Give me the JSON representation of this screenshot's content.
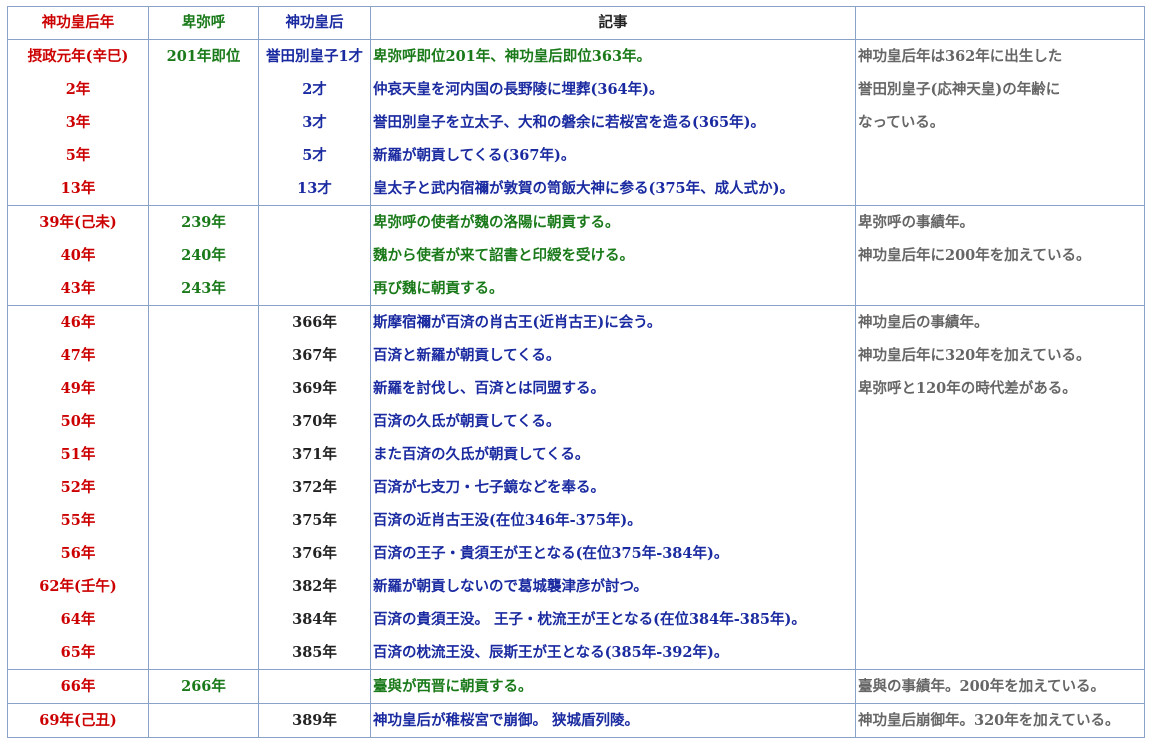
{
  "headers": [
    "神功皇后年",
    "卑弥呼",
    "神功皇后",
    "記事",
    ""
  ],
  "rows": [
    {
      "g": true,
      "c0": "摂政元年(辛巳)",
      "c0c": "red",
      "c1": "201年即位",
      "c2": "誉田別皇子1才",
      "c3": "卑弥呼即位201年、神功皇后即位363年。",
      "c3c": "green",
      "c4": "神功皇后年は362年に出生した"
    },
    {
      "g": false,
      "c0": "2年",
      "c0c": "red",
      "c1": "",
      "c2": "2才",
      "c3": "仲哀天皇を河内国の長野陵に埋葬(364年)。",
      "c3c": "blue",
      "c4": "誉田別皇子(応神天皇)の年齢に"
    },
    {
      "g": false,
      "c0": "3年",
      "c0c": "red",
      "c1": "",
      "c2": "3才",
      "c3": "誉田別皇子を立太子、大和の磐余に若桜宮を造る(365年)。",
      "c3c": "blue",
      "c4": "なっている。"
    },
    {
      "g": false,
      "c0": "5年",
      "c0c": "red",
      "c1": "",
      "c2": "5才",
      "c3": "新羅が朝貢してくる(367年)。",
      "c3c": "blue",
      "c4": ""
    },
    {
      "g": false,
      "c0": "13年",
      "c0c": "red",
      "c1": "",
      "c2": "13才",
      "c3": "皇太子と武内宿禰が敦賀の笥飯大神に参る(375年、成人式か)。",
      "c3c": "blue",
      "c4": ""
    },
    {
      "g": true,
      "c0": "39年(己未)",
      "c0c": "red",
      "c1": "239年",
      "c2": "",
      "c3": "卑弥呼の使者が魏の洛陽に朝貢する。",
      "c3c": "green",
      "c4": "卑弥呼の事績年。"
    },
    {
      "g": false,
      "c0": "40年",
      "c0c": "red",
      "c1": "240年",
      "c2": "",
      "c3": "魏から使者が来て詔書と印綬を受ける。",
      "c3c": "green",
      "c4": "神功皇后年に200年を加えている。"
    },
    {
      "g": false,
      "c0": "43年",
      "c0c": "red",
      "c1": "243年",
      "c2": "",
      "c3": "再び魏に朝貢する。",
      "c3c": "green",
      "c4": ""
    },
    {
      "g": true,
      "c0": "46年",
      "c0c": "red",
      "c1": "",
      "c2": "366年",
      "c3": "斯摩宿禰が百済の肖古王(近肖古王)に会う。",
      "c3c": "blue",
      "c4": "神功皇后の事績年。"
    },
    {
      "g": false,
      "c0": "47年",
      "c0c": "red",
      "c1": "",
      "c2": "367年",
      "c3": "百済と新羅が朝貢してくる。",
      "c3c": "blue",
      "c4": "神功皇后年に320年を加えている。"
    },
    {
      "g": false,
      "c0": "49年",
      "c0c": "red",
      "c1": "",
      "c2": "369年",
      "c3": "新羅を討伐し、百済とは同盟する。",
      "c3c": "blue",
      "c4": "卑弥呼と120年の時代差がある。"
    },
    {
      "g": false,
      "c0": "50年",
      "c0c": "red",
      "c1": "",
      "c2": "370年",
      "c3": "百済の久氐が朝貢してくる。",
      "c3c": "blue",
      "c4": ""
    },
    {
      "g": false,
      "c0": "51年",
      "c0c": "red",
      "c1": "",
      "c2": "371年",
      "c3": "また百済の久氐が朝貢してくる。",
      "c3c": "blue",
      "c4": ""
    },
    {
      "g": false,
      "c0": "52年",
      "c0c": "red",
      "c1": "",
      "c2": "372年",
      "c3": "百済が七支刀・七子鏡などを奉る。",
      "c3c": "blue",
      "c4": ""
    },
    {
      "g": false,
      "c0": "55年",
      "c0c": "red",
      "c1": "",
      "c2": "375年",
      "c3": "百済の近肖古王没(在位346年-375年)。",
      "c3c": "blue",
      "c4": ""
    },
    {
      "g": false,
      "c0": "56年",
      "c0c": "red",
      "c1": "",
      "c2": "376年",
      "c3": "百済の王子・貴須王が王となる(在位375年-384年)。",
      "c3c": "blue",
      "c4": ""
    },
    {
      "g": false,
      "c0": "62年(壬午)",
      "c0c": "red",
      "c1": "",
      "c2": "382年",
      "c3": "新羅が朝貢しないので葛城襲津彦が討つ。",
      "c3c": "blue",
      "c4": ""
    },
    {
      "g": false,
      "c0": "64年",
      "c0c": "red",
      "c1": "",
      "c2": "384年",
      "c3": "百済の貴須王没。 王子・枕流王が王となる(在位384年-385年)。",
      "c3c": "blue",
      "c4": ""
    },
    {
      "g": false,
      "c0": "65年",
      "c0c": "red",
      "c1": "",
      "c2": "385年",
      "c3": "百済の枕流王没、辰斯王が王となる(385年-392年)。",
      "c3c": "blue",
      "c4": ""
    },
    {
      "g": true,
      "c0": "66年",
      "c0c": "red",
      "c1": "266年",
      "c2": "",
      "c3": "臺與が西晋に朝貢する。",
      "c3c": "green",
      "c4": "臺與の事績年。200年を加えている。"
    },
    {
      "g": true,
      "c0": "69年(己丑)",
      "c0c": "red",
      "c1": "",
      "c2": "389年",
      "c3": "神功皇后が稚桜宮で崩御。 狭城盾列陵。",
      "c3c": "blue",
      "c4": "神功皇后崩御年。320年を加えている。"
    }
  ]
}
